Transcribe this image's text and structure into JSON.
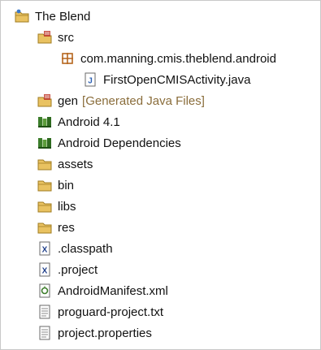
{
  "tree": {
    "project": {
      "label": "The Blend",
      "icon": "project-folder-icon"
    },
    "src": {
      "label": "src",
      "icon": "source-folder-icon"
    },
    "package": {
      "label": "com.manning.cmis.theblend.android",
      "icon": "package-icon"
    },
    "java_file": {
      "label": "FirstOpenCMISActivity.java",
      "icon": "java-file-icon"
    },
    "gen": {
      "label": "gen",
      "decoration": "[Generated Java Files]",
      "icon": "source-folder-icon"
    },
    "android_lib": {
      "label": "Android 4.1",
      "icon": "library-icon"
    },
    "android_deps": {
      "label": "Android Dependencies",
      "icon": "library-icon"
    },
    "assets": {
      "label": "assets",
      "icon": "folder-icon"
    },
    "bin": {
      "label": "bin",
      "icon": "folder-icon"
    },
    "libs": {
      "label": "libs",
      "icon": "folder-icon"
    },
    "res": {
      "label": "res",
      "icon": "folder-icon"
    },
    "classpath": {
      "label": ".classpath",
      "icon": "xml-file-icon"
    },
    "project_file": {
      "label": ".project",
      "icon": "xml-file-icon"
    },
    "manifest": {
      "label": "AndroidManifest.xml",
      "icon": "android-manifest-icon"
    },
    "proguard": {
      "label": "proguard-project.txt",
      "icon": "text-file-icon"
    },
    "properties": {
      "label": "project.properties",
      "icon": "text-file-icon"
    }
  },
  "colors": {
    "folder": "#e9c261",
    "folder_stroke": "#a07c22",
    "package": "#b5651d",
    "java": "#2b5fb3",
    "library": "#3c7d2a",
    "decoration": "#8a6d3b"
  }
}
